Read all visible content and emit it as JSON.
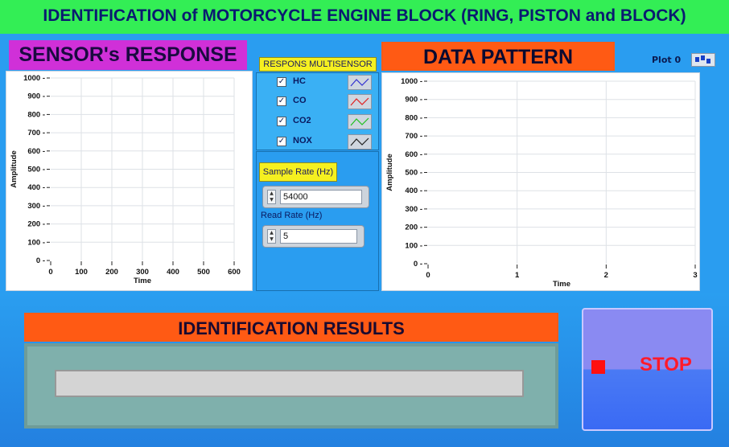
{
  "title": "IDENTIFICATION of MOTORCYCLE ENGINE BLOCK (RING, PISTON and BLOCK)",
  "sensor_panel": {
    "label": "SENSOR's RESPONSE",
    "x_label": "Time",
    "y_label": "Amplitude",
    "y_ticks": [
      "0",
      "100",
      "200",
      "300",
      "400",
      "500",
      "600",
      "700",
      "800",
      "900",
      "1000"
    ],
    "x_ticks": [
      "0",
      "100",
      "200",
      "300",
      "400",
      "500",
      "600"
    ]
  },
  "multisensor": {
    "label": "RESPONS MULTISENSOR",
    "items": [
      {
        "name": "HC",
        "checked": true,
        "color": "#3030d0"
      },
      {
        "name": "CO",
        "checked": true,
        "color": "#e02020"
      },
      {
        "name": "CO2",
        "checked": true,
        "color": "#20c020"
      },
      {
        "name": "NOX",
        "checked": true,
        "color": "#202020"
      }
    ]
  },
  "controls": {
    "sample_rate_label": "Sample Rate (Hz)",
    "sample_rate_value": "54000",
    "read_rate_label": "Read Rate (Hz)",
    "read_rate_value": "5"
  },
  "pattern_panel": {
    "label": "DATA PATTERN",
    "plot_legend": "Plot 0",
    "x_label": "Time",
    "y_label": "Amplitude",
    "y_ticks": [
      "0",
      "100",
      "200",
      "300",
      "400",
      "500",
      "600",
      "700",
      "800",
      "900",
      "1000"
    ],
    "x_ticks": [
      "0",
      "1",
      "2",
      "3"
    ]
  },
  "results": {
    "label": "IDENTIFICATION RESULTS",
    "value": ""
  },
  "stop_button": {
    "label": "STOP",
    "led_color": "#ff1010"
  }
}
